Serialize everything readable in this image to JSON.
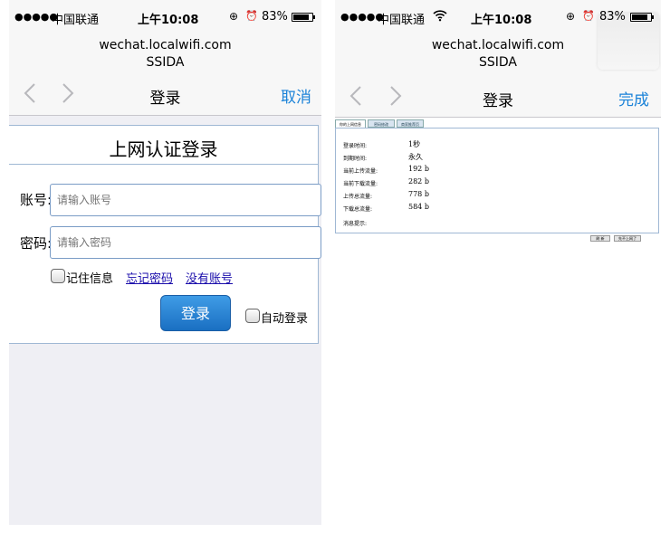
{
  "left": {
    "status": {
      "signal": "●●●●●",
      "carrier": "中国联通",
      "time": "上午10:08",
      "lock_glyph": "⊕",
      "alarm_glyph": "⏰",
      "battery_pct": "83%",
      "battery_level": 0.83
    },
    "url": "wechat.localwifi.com",
    "ssid": "SSIDA",
    "nav": {
      "title": "登录",
      "action": "取消"
    },
    "form": {
      "title": "上网认证登录",
      "account_label": "账号:",
      "account_placeholder": "请输入账号",
      "password_label": "密码:",
      "password_placeholder": "请输入密码",
      "remember_label": "记住信息",
      "forgot_link": "忘记密码",
      "no_account_link": "没有账号",
      "login_button": "登录",
      "auto_login_label": "自动登录"
    }
  },
  "right": {
    "status": {
      "signal": "●●●●●",
      "carrier": "中国联通",
      "time": "上午10:08",
      "lock_glyph": "⊕",
      "alarm_glyph": "⏰",
      "battery_pct": "83%",
      "battery_level": 0.83
    },
    "url": "wechat.localwifi.com",
    "ssid": "SSIDA",
    "nav": {
      "title": "登录",
      "action": "完成"
    },
    "tabs": [
      "你的上网信息",
      "密码修改",
      "商家推荐页"
    ],
    "rows": [
      {
        "label": "登录时间:",
        "value": "1秒"
      },
      {
        "label": "到期时间:",
        "value": "永久"
      },
      {
        "label": "当前上传流量:",
        "value": "192 b"
      },
      {
        "label": "当前下载流量:",
        "value": "282 b"
      },
      {
        "label": "上传总流量:",
        "value": "778 b"
      },
      {
        "label": "下载总流量:",
        "value": "584 b"
      },
      {
        "label": "消息提示:",
        "value": ""
      }
    ],
    "buttons": [
      "刷 新",
      "先不上网了"
    ]
  }
}
